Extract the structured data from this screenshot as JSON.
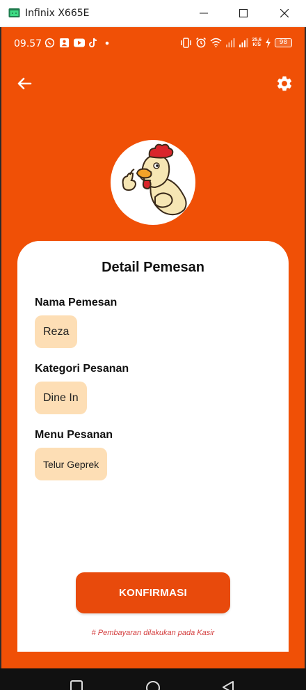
{
  "window": {
    "title": "Infinix X665E",
    "icon": "android-emulator-icon",
    "controls": [
      "minimize-icon",
      "maximize-icon",
      "close-icon"
    ]
  },
  "status_bar": {
    "time": "09.57",
    "left_icons": [
      "whatsapp-icon",
      "contacts-icon",
      "youtube-icon",
      "tiktok-icon",
      "dot-icon"
    ],
    "right_icons": [
      "vibrate-icon",
      "alarm-icon",
      "wifi-icon",
      "signal-icon",
      "signal-icon",
      "charging-icon"
    ],
    "network_speed": "25,6",
    "network_speed_unit": "K/S",
    "battery": "98"
  },
  "app_bar": {
    "back_icon": "arrow-left-icon",
    "settings_icon": "gear-icon"
  },
  "logo": {
    "icon": "chicken-mascot-logo"
  },
  "card": {
    "title": "Detail Pemesan",
    "fields": [
      {
        "label": "Nama Pemesan",
        "value": "Reza"
      },
      {
        "label": "Kategori Pesanan",
        "value": "Dine In"
      },
      {
        "label": "Menu Pesanan",
        "value": "Telur Geprek"
      }
    ],
    "confirm_label": "KONFIRMASI",
    "note": "# Pembayaran dilakukan pada Kasir"
  },
  "nav_bar": {
    "icons": [
      "recent-apps-icon",
      "home-icon",
      "back-triangle-icon"
    ]
  },
  "colors": {
    "primary": "#F05006",
    "button": "#E84A0C",
    "chip": "#FDDEB5",
    "note": "#D44040"
  }
}
